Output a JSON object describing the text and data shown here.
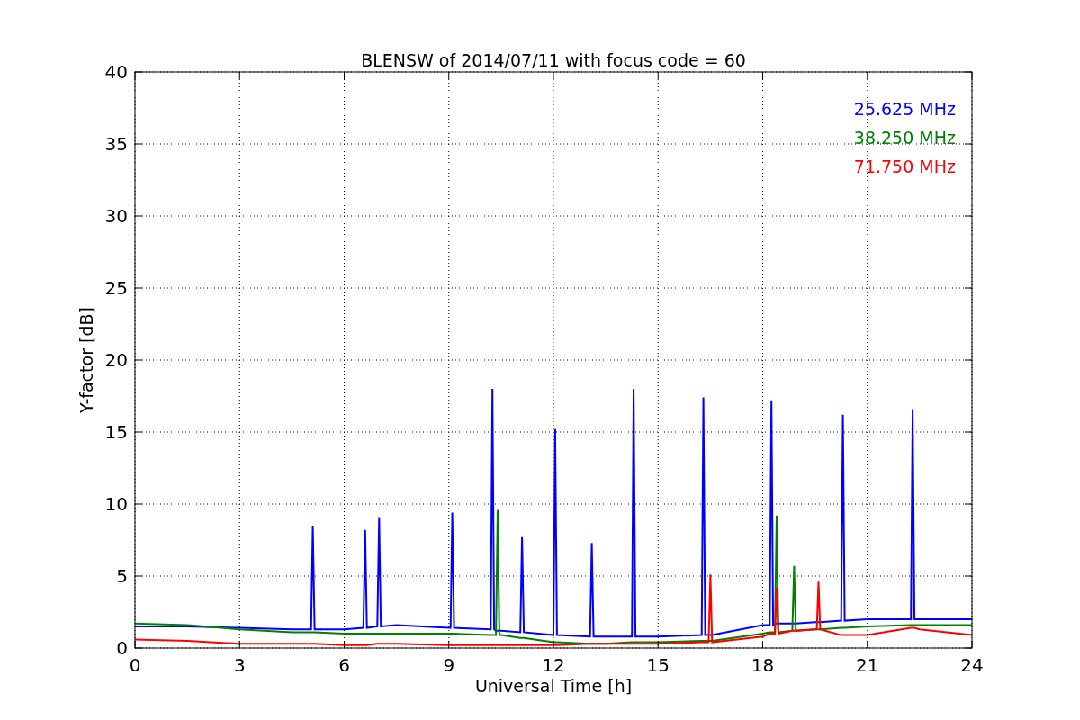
{
  "figure": {
    "chart_data": {
      "type": "line",
      "title": "BLENSW of 2014/07/11 with focus code = 60",
      "xlabel": "Universal Time [h]",
      "ylabel": "Y-factor [dB]",
      "x": [
        0,
        1.5,
        3,
        4.5,
        5.05,
        5.1,
        5.15,
        6,
        6.55,
        6.6,
        6.65,
        6.95,
        7.0,
        7.05,
        7.5,
        9,
        9.05,
        9.1,
        9.15,
        10.2,
        10.25,
        10.3,
        10.35,
        10.4,
        10.45,
        10.5,
        11.05,
        11.1,
        11.15,
        12,
        12.05,
        12.1,
        13.05,
        13.1,
        13.15,
        13.5,
        14.25,
        14.3,
        14.35,
        15,
        16.25,
        16.3,
        16.35,
        16.45,
        16.5,
        16.55,
        18,
        18.2,
        18.25,
        18.3,
        18.35,
        18.4,
        18.45,
        18.85,
        18.9,
        18.95,
        19.5,
        19.55,
        19.6,
        19.65,
        20.25,
        20.3,
        20.35,
        21,
        22.25,
        22.3,
        22.35,
        22.5,
        24
      ],
      "series": [
        {
          "name": "25.625 MHz",
          "color": "#0000ff",
          "values": [
            1.5,
            1.5,
            1.4,
            1.3,
            1.3,
            8.5,
            1.3,
            1.3,
            1.4,
            8.2,
            1.4,
            1.5,
            9.1,
            1.5,
            1.6,
            1.4,
            1.4,
            9.4,
            1.4,
            1.3,
            18.0,
            1.3,
            1.2,
            1.2,
            1.2,
            1.2,
            1.1,
            7.7,
            1.1,
            0.9,
            15.2,
            0.9,
            0.8,
            7.3,
            0.8,
            0.8,
            0.8,
            18.0,
            0.8,
            0.8,
            0.9,
            17.4,
            0.9,
            0.9,
            0.9,
            0.9,
            1.6,
            1.6,
            17.2,
            1.6,
            1.7,
            1.7,
            1.7,
            1.7,
            1.7,
            1.7,
            1.8,
            1.8,
            1.8,
            1.8,
            1.9,
            16.2,
            1.9,
            2.0,
            2.0,
            16.6,
            2.0,
            2.0,
            2.0
          ]
        },
        {
          "name": "38.250 MHz",
          "color": "#008000",
          "values": [
            1.7,
            1.6,
            1.3,
            1.1,
            1.1,
            1.1,
            1.1,
            1.0,
            1.0,
            1.0,
            1.0,
            1.0,
            1.0,
            1.0,
            1.0,
            1.0,
            1.0,
            1.0,
            1.0,
            0.9,
            0.9,
            0.9,
            0.9,
            9.6,
            0.9,
            0.9,
            0.7,
            0.7,
            0.7,
            0.4,
            0.4,
            0.4,
            0.3,
            0.3,
            0.3,
            0.3,
            0.4,
            0.4,
            0.4,
            0.4,
            0.5,
            0.5,
            0.5,
            0.5,
            0.5,
            0.5,
            1.0,
            1.1,
            1.1,
            1.1,
            1.1,
            9.2,
            1.1,
            1.2,
            5.7,
            1.2,
            1.3,
            1.3,
            1.3,
            1.3,
            1.4,
            1.4,
            1.4,
            1.5,
            1.6,
            1.6,
            1.6,
            1.6,
            1.6
          ]
        },
        {
          "name": "71.750 MHz",
          "color": "#ff0000",
          "values": [
            0.6,
            0.5,
            0.3,
            0.3,
            0.3,
            0.3,
            0.3,
            0.2,
            0.2,
            0.2,
            0.2,
            0.3,
            0.3,
            0.3,
            0.3,
            0.2,
            0.2,
            0.2,
            0.2,
            0.2,
            0.2,
            0.2,
            0.2,
            0.2,
            0.2,
            0.2,
            0.2,
            0.2,
            0.2,
            0.2,
            0.2,
            0.2,
            0.3,
            0.3,
            0.3,
            0.3,
            0.3,
            0.3,
            0.3,
            0.3,
            0.4,
            0.4,
            0.4,
            0.4,
            5.1,
            0.4,
            0.8,
            1.0,
            1.0,
            1.0,
            1.0,
            4.2,
            1.0,
            1.2,
            1.2,
            1.2,
            1.3,
            1.3,
            4.6,
            1.3,
            0.9,
            0.9,
            0.9,
            0.9,
            1.4,
            1.4,
            1.4,
            1.3,
            0.9
          ]
        }
      ],
      "xlim": [
        0,
        24
      ],
      "ylim": [
        0,
        40
      ],
      "grid": true,
      "xticks": [
        0,
        3,
        6,
        9,
        12,
        15,
        18,
        21,
        24
      ],
      "yticks": [
        0,
        5,
        10,
        15,
        20,
        25,
        30,
        35,
        40
      ]
    }
  }
}
